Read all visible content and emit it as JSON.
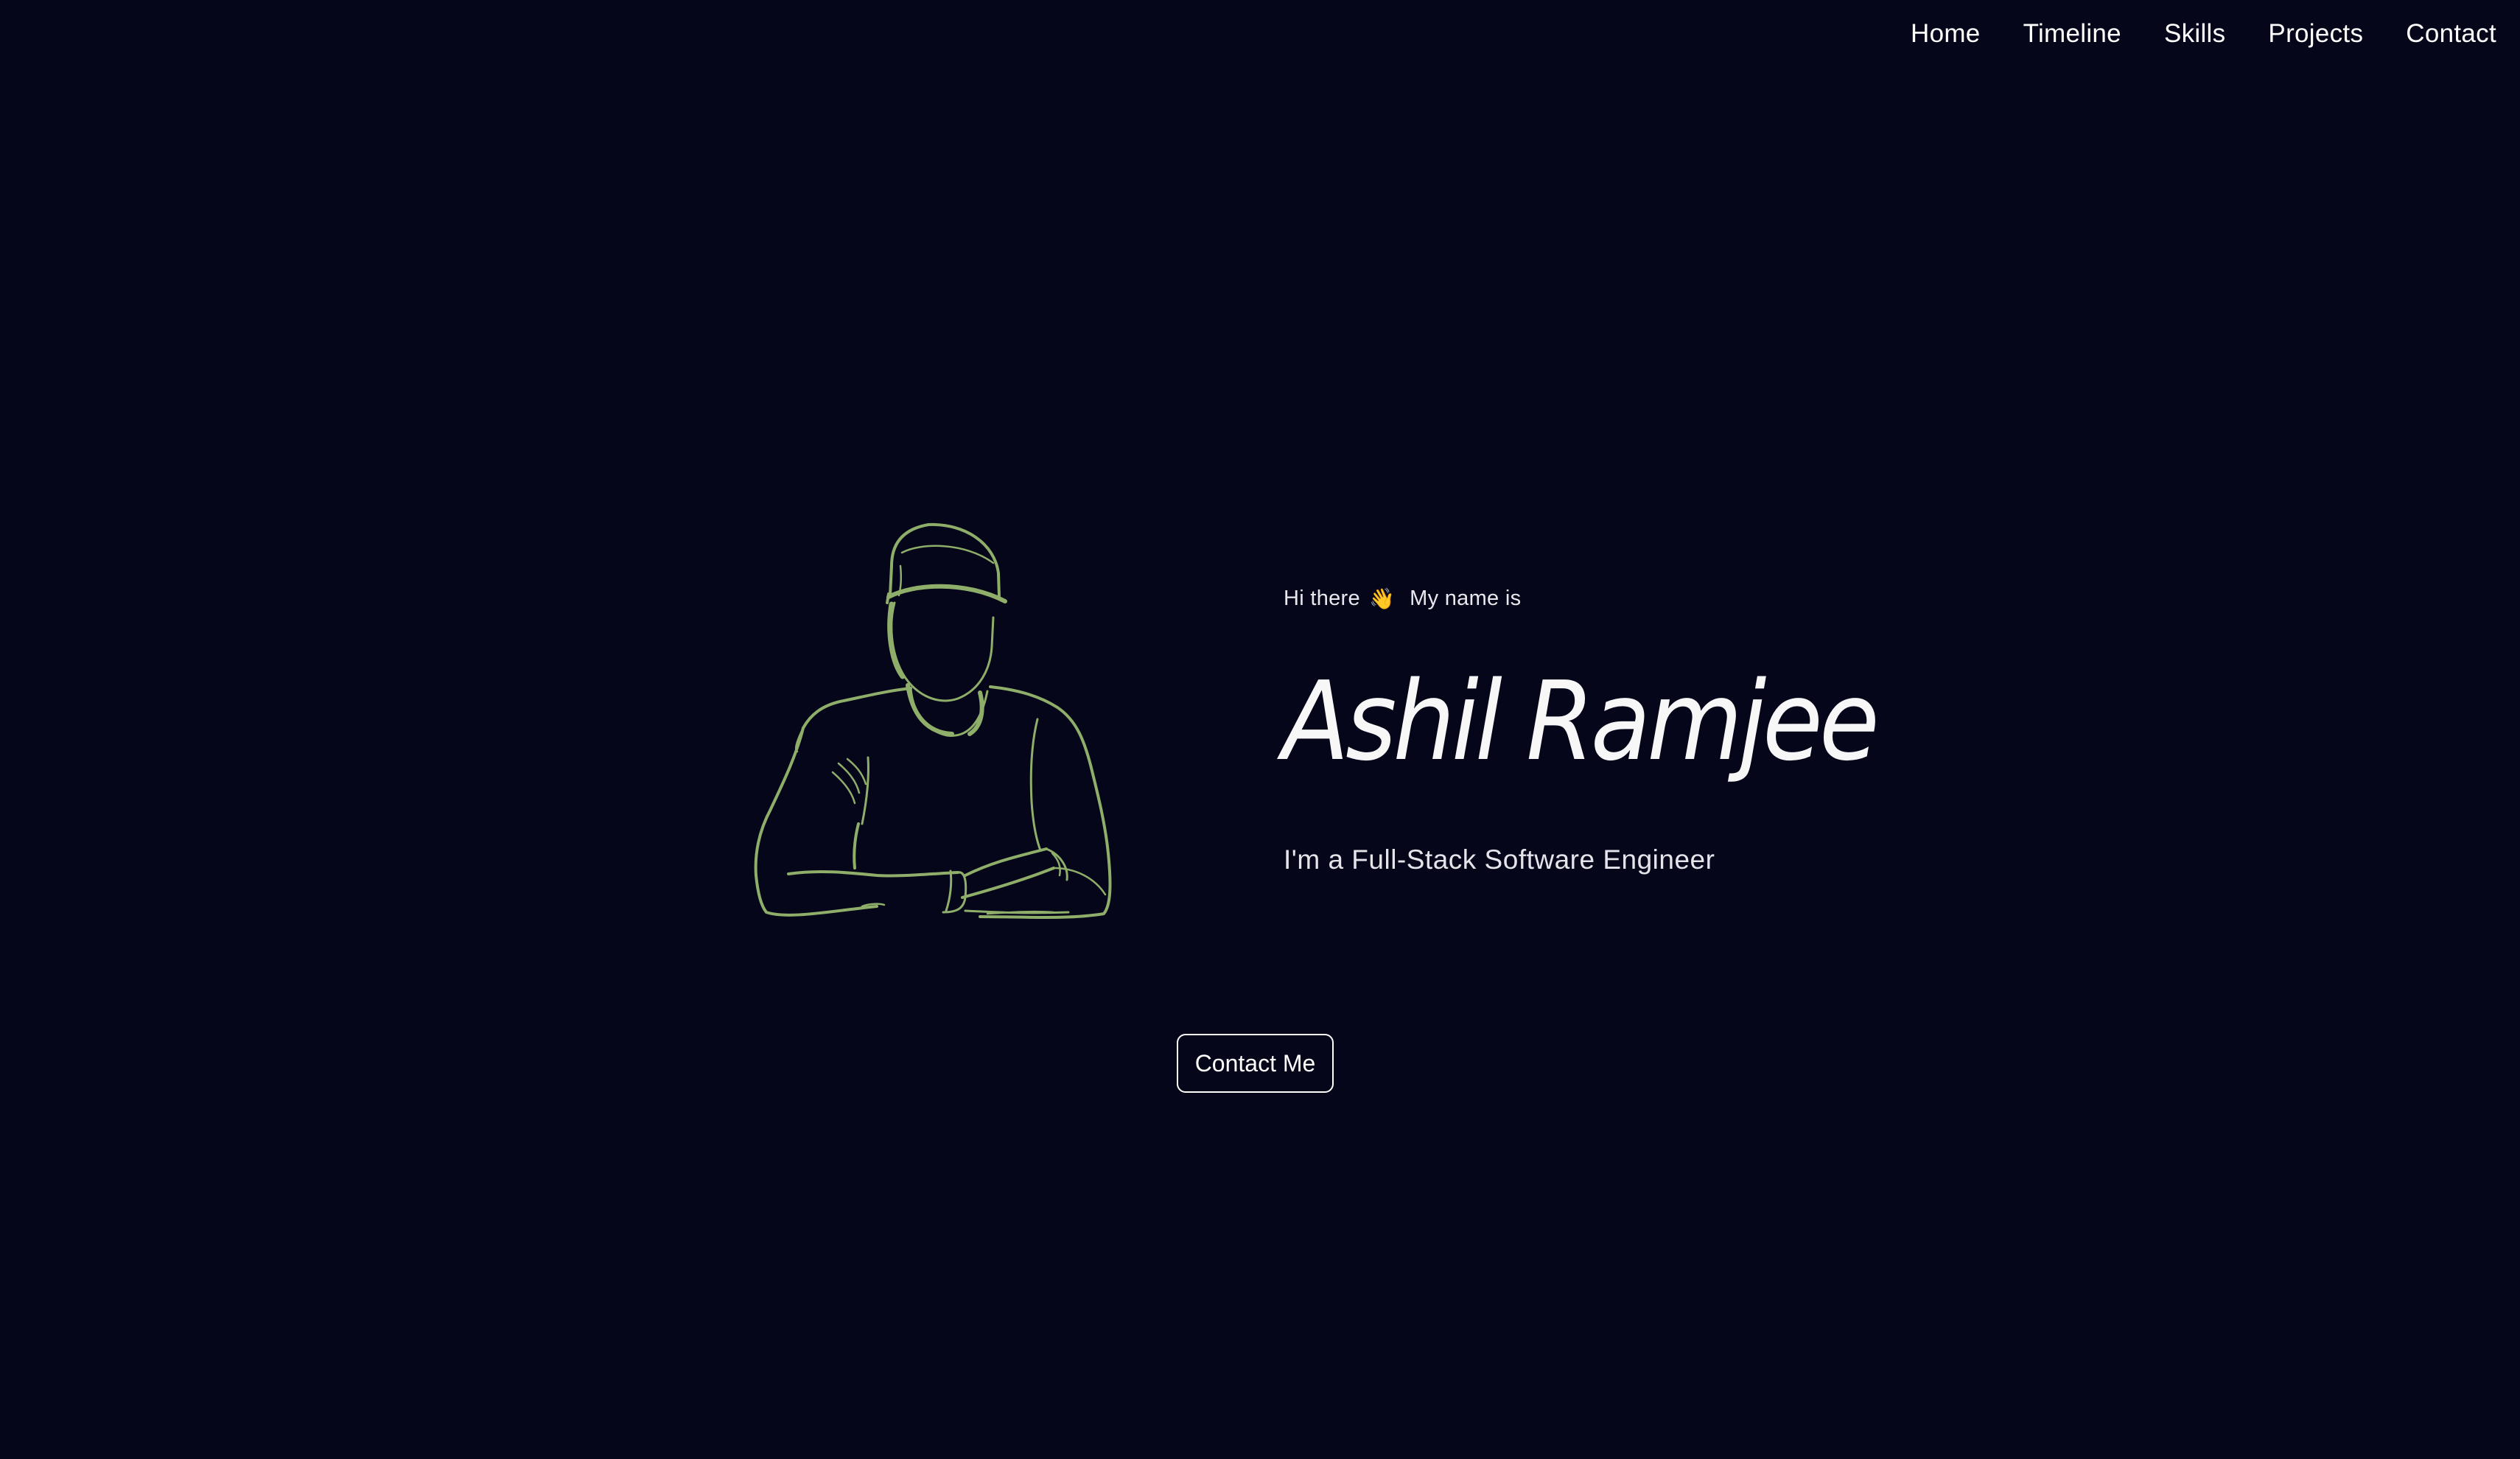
{
  "nav": {
    "items": [
      {
        "label": "Home"
      },
      {
        "label": "Timeline"
      },
      {
        "label": "Skills"
      },
      {
        "label": "Projects"
      },
      {
        "label": "Contact"
      }
    ]
  },
  "hero": {
    "greeting": "Hi there",
    "wave_emoji": "👋",
    "intro_suffix": "My name is",
    "name": "Ashil Ramjee",
    "role": "I'm a Full-Stack Software Engineer",
    "cta_label": "Contact Me",
    "portrait_icon": "person-line-art-icon"
  },
  "colors": {
    "background": "#05061a",
    "accent": "#8fae6a",
    "text": "#ffffff"
  }
}
